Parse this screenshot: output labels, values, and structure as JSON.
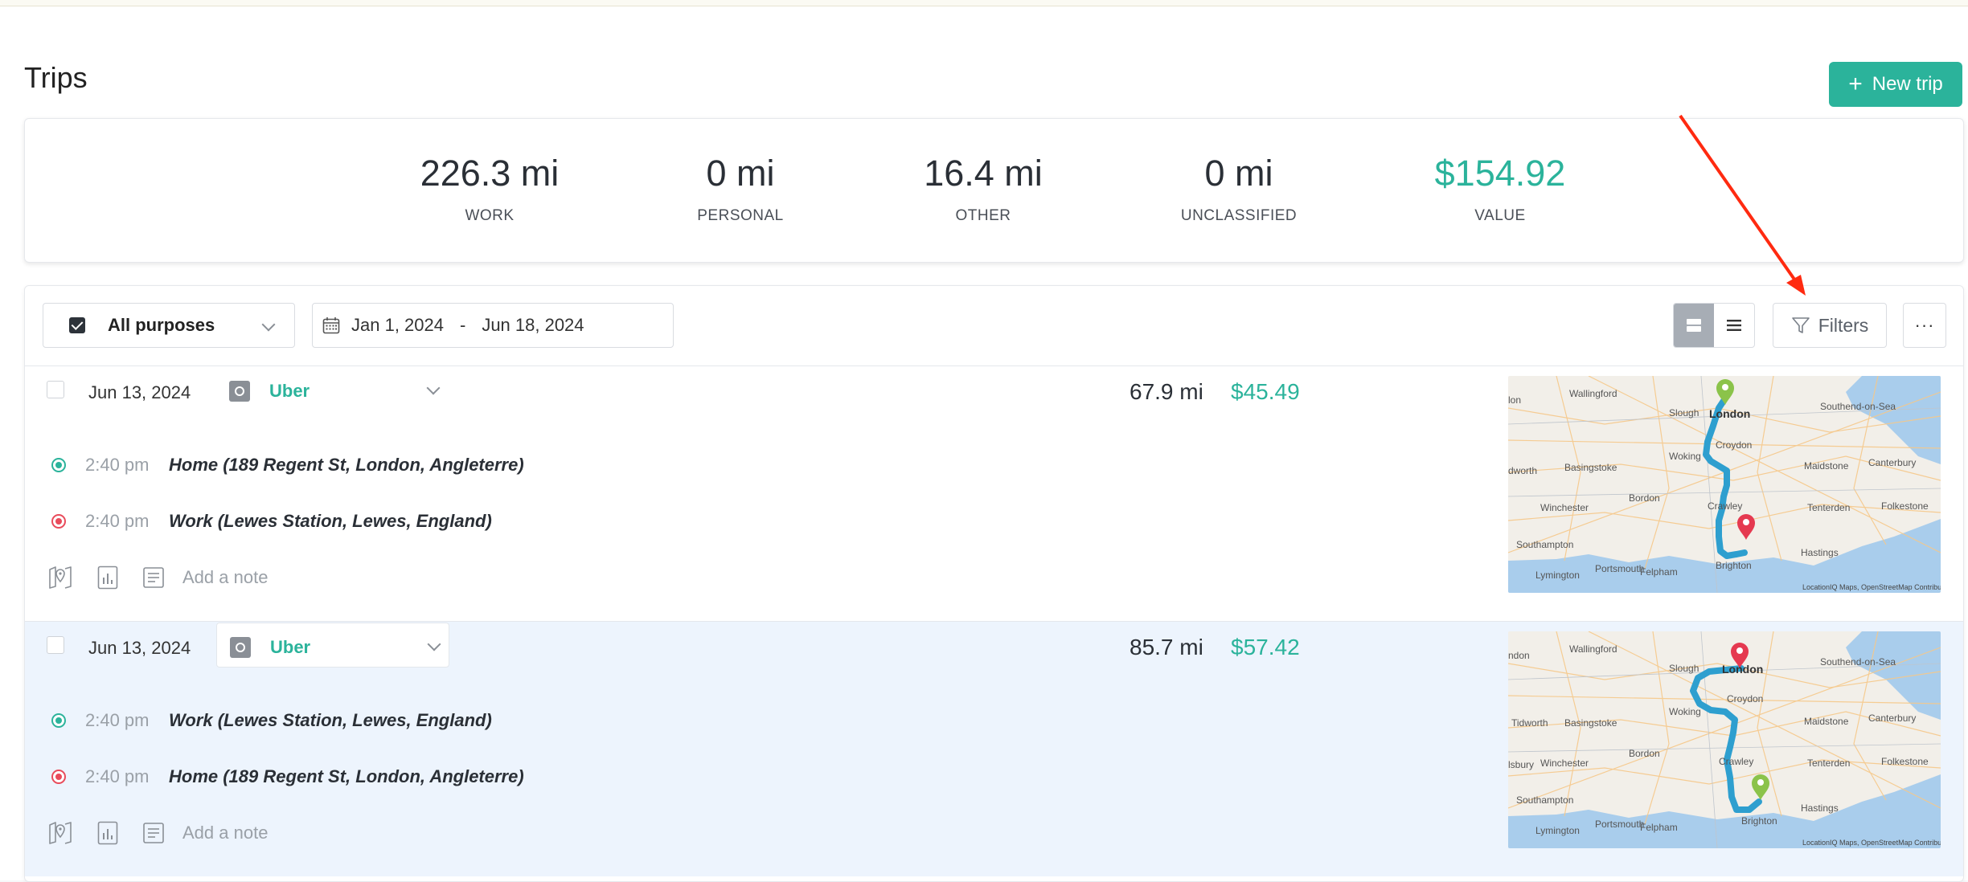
{
  "page": {
    "title": "Trips",
    "new_trip_label": "New trip"
  },
  "summary": [
    {
      "value": "226.3 mi",
      "label": "WORK"
    },
    {
      "value": "0 mi",
      "label": "PERSONAL"
    },
    {
      "value": "16.4 mi",
      "label": "OTHER"
    },
    {
      "value": "0 mi",
      "label": "UNCLASSIFIED"
    },
    {
      "value": "$154.92",
      "label": "VALUE"
    }
  ],
  "filters": {
    "purpose_label": "All purposes",
    "date_from": "Jan 1, 2024",
    "date_separator": "-",
    "date_to": "Jun 18, 2024",
    "filters_label": "Filters",
    "more_label": "···"
  },
  "trips": [
    {
      "date": "Jun 13, 2024",
      "purpose": "Uber",
      "distance": "67.9 mi",
      "amount": "$45.49",
      "start": {
        "time": "2:40 pm",
        "address": "Home (189 Regent St, London, Angleterre)"
      },
      "end": {
        "time": "2:40 pm",
        "address": "Work (Lewes Station, Lewes, England)"
      },
      "note_placeholder": "Add a note"
    },
    {
      "date": "Jun 13, 2024",
      "purpose": "Uber",
      "distance": "85.7 mi",
      "amount": "$57.42",
      "start": {
        "time": "2:40 pm",
        "address": "Work (Lewes Station, Lewes, England)"
      },
      "end": {
        "time": "2:40 pm",
        "address": "Home (189 Regent St, London, Angleterre)"
      },
      "note_placeholder": "Add a note"
    }
  ],
  "map": {
    "cities": [
      "Wallingford",
      "Slough",
      "London",
      "Southend-on-Sea",
      "Croydon",
      "Woking",
      "Basingstoke",
      "Maidstone",
      "Canterbury",
      "Crawley",
      "Bordon",
      "Winchester",
      "Tenterden",
      "Folkestone",
      "Southampton",
      "Hastings",
      "Lymington",
      "Portsmouth",
      "Felpham",
      "Brighton"
    ],
    "map1_edge": [
      "lon",
      "dworth"
    ],
    "map2_edge": [
      "ndon",
      "Tidworth",
      "lsbury"
    ],
    "attribution": "LocationIQ Maps, OpenStreetMap Contributors",
    "colors": {
      "route": "#2e9fcf",
      "start_pin": "#8bc34a",
      "end_pin": "#e53950",
      "land": "#f2efe9",
      "water": "#a9cdec"
    }
  },
  "colors": {
    "accent": "#2bb39b",
    "annotation_arrow": "#ff2a10"
  }
}
